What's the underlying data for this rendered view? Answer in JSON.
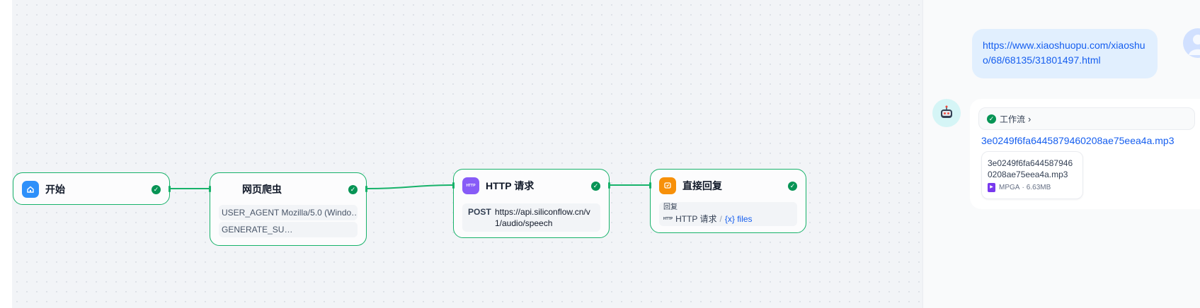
{
  "workflow": {
    "nodes": {
      "start": {
        "title": "开始",
        "icon": "home-icon"
      },
      "crawler": {
        "title": "网页爬虫",
        "vars": [
          "USER_AGENT Mozilla/5.0 (Windo…",
          "GENERATE_SU…"
        ]
      },
      "http": {
        "title": "HTTP 请求",
        "icon_text": "HTTP",
        "method": "POST",
        "url": "https://api.siliconflow.cn/v1/audio/speech"
      },
      "reply": {
        "title": "直接回复",
        "label": "回复",
        "ref_icon": "HTTP",
        "ref_node": "HTTP 请求",
        "ref_sep": "/",
        "ref_var": "{x} files"
      }
    },
    "colors": {
      "success": "#17b26a",
      "start": "#2e90fa",
      "http": "#875bf7",
      "reply": "#f79009"
    }
  },
  "chat": {
    "user_message": "https://www.xiaoshuopu.com/xiaoshuo/68/68135/31801497.html",
    "bot": {
      "workflow_label": "工作流",
      "file_link": "3e0249f6fa6445879460208ae75eea4a.mp3",
      "file": {
        "name": "3e0249f6fa6445879460208ae75eea4a.mp3",
        "type": "MPGA",
        "separator": "·",
        "size": "6.63MB"
      }
    }
  }
}
